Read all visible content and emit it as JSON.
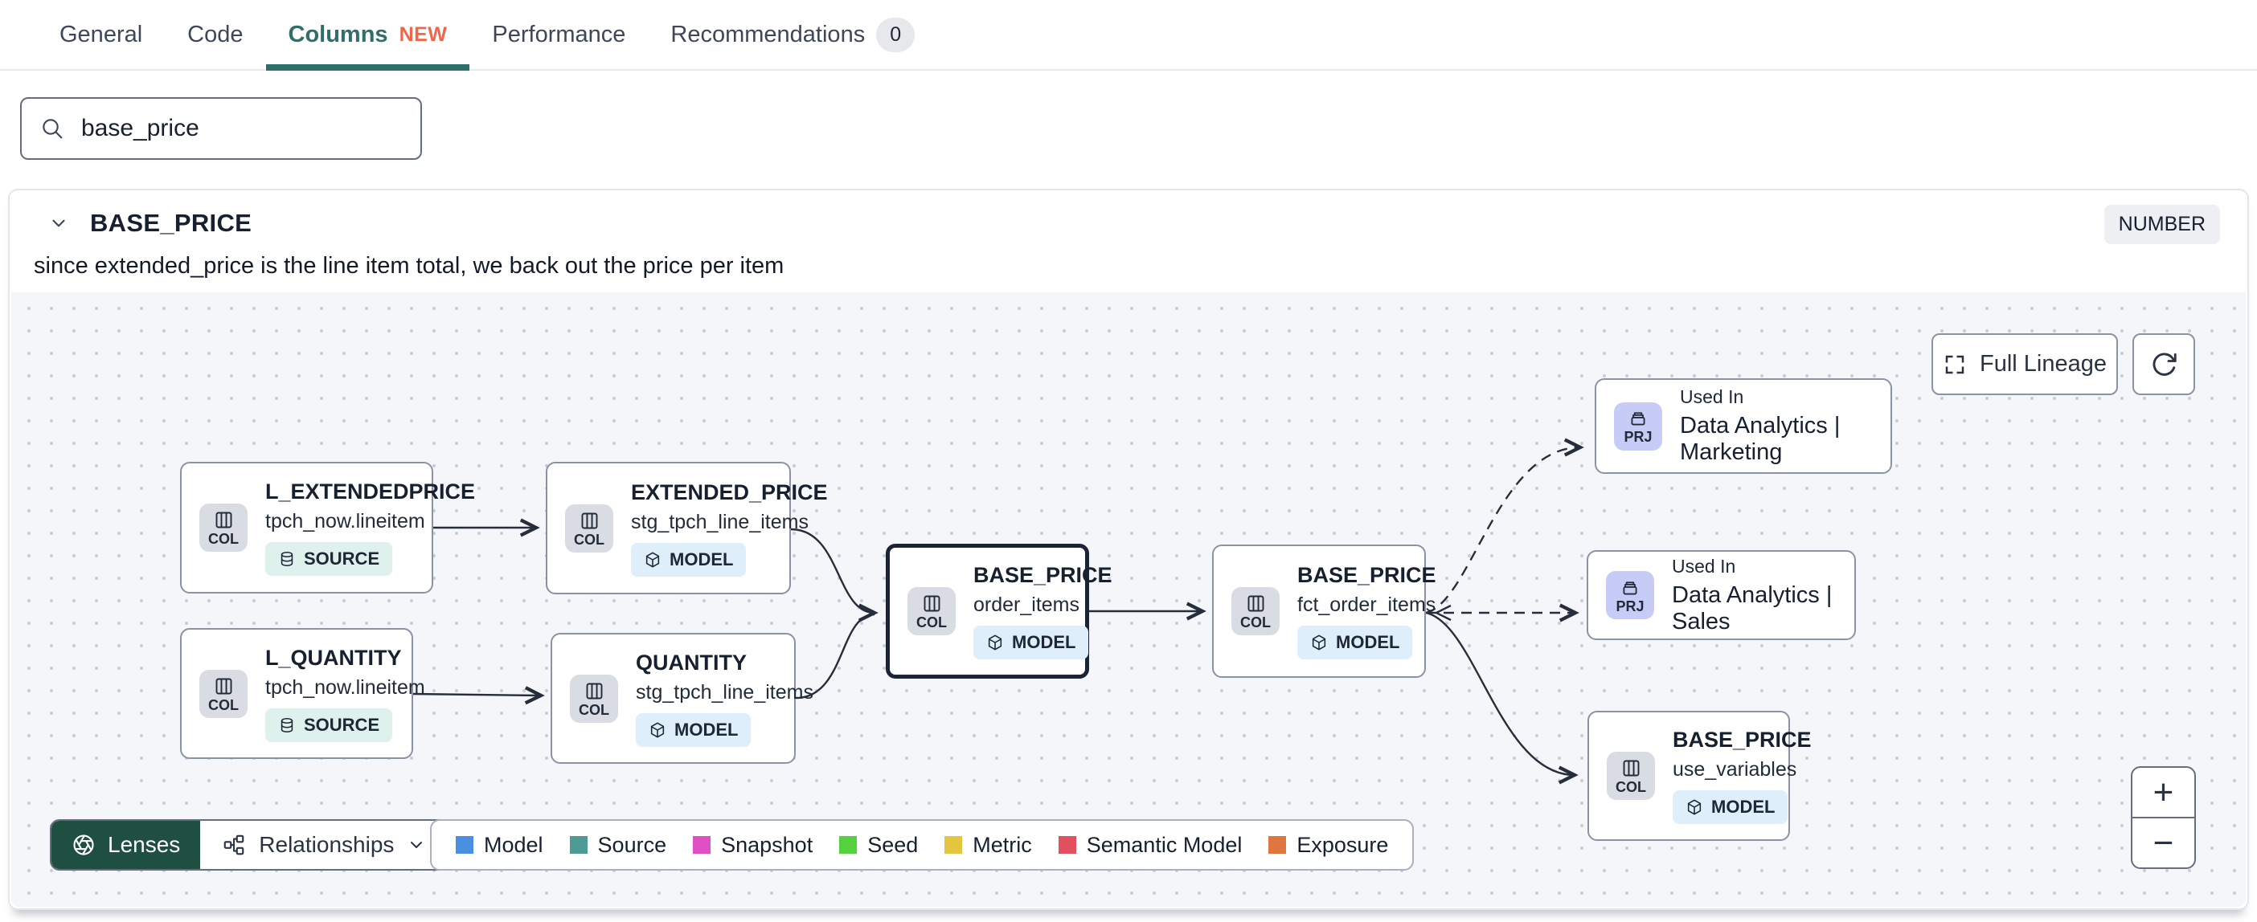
{
  "tabs": [
    {
      "label": "General"
    },
    {
      "label": "Code"
    },
    {
      "label": "Columns",
      "badge": "NEW"
    },
    {
      "label": "Performance"
    },
    {
      "label": "Recommendations",
      "count": "0"
    }
  ],
  "search": {
    "value": "base_price"
  },
  "column": {
    "name": "BASE_PRICE",
    "type": "NUMBER",
    "description": "since extended_price is the line item total, we back out the price per item"
  },
  "lineage": {
    "full_lineage_label": "Full Lineage",
    "zoom_in_label": "+",
    "zoom_out_label": "−",
    "lenses_label": "Lenses",
    "relationships_label": "Relationships",
    "nodes": [
      {
        "kind": "COL",
        "title": "L_EXTENDEDPRICE",
        "subtitle": "tpch_now.lineitem",
        "badge": "SOURCE"
      },
      {
        "kind": "COL",
        "title": "L_QUANTITY",
        "subtitle": "tpch_now.lineitem",
        "badge": "SOURCE"
      },
      {
        "kind": "COL",
        "title": "EXTENDED_PRICE",
        "subtitle": "stg_tpch_line_items",
        "badge": "MODEL"
      },
      {
        "kind": "COL",
        "title": "QUANTITY",
        "subtitle": "stg_tpch_line_items",
        "badge": "MODEL"
      },
      {
        "kind": "COL",
        "title": "BASE_PRICE",
        "subtitle": "order_items",
        "badge": "MODEL"
      },
      {
        "kind": "COL",
        "title": "BASE_PRICE",
        "subtitle": "fct_order_items",
        "badge": "MODEL"
      },
      {
        "kind": "PRJ",
        "used_in": "Used In",
        "title": "Data Analytics | Marketing"
      },
      {
        "kind": "PRJ",
        "used_in": "Used In",
        "title": "Data Analytics | Sales"
      },
      {
        "kind": "COL",
        "title": "BASE_PRICE",
        "subtitle": "use_variables",
        "badge": "MODEL"
      }
    ],
    "legend": [
      {
        "label": "Model",
        "color": "#4a8fe0"
      },
      {
        "label": "Source",
        "color": "#4e9b96"
      },
      {
        "label": "Snapshot",
        "color": "#e14fc4"
      },
      {
        "label": "Seed",
        "color": "#56d13e"
      },
      {
        "label": "Metric",
        "color": "#e3c63e"
      },
      {
        "label": "Semantic Model",
        "color": "#e0505e"
      },
      {
        "label": "Exposure",
        "color": "#e0763f"
      }
    ]
  }
}
